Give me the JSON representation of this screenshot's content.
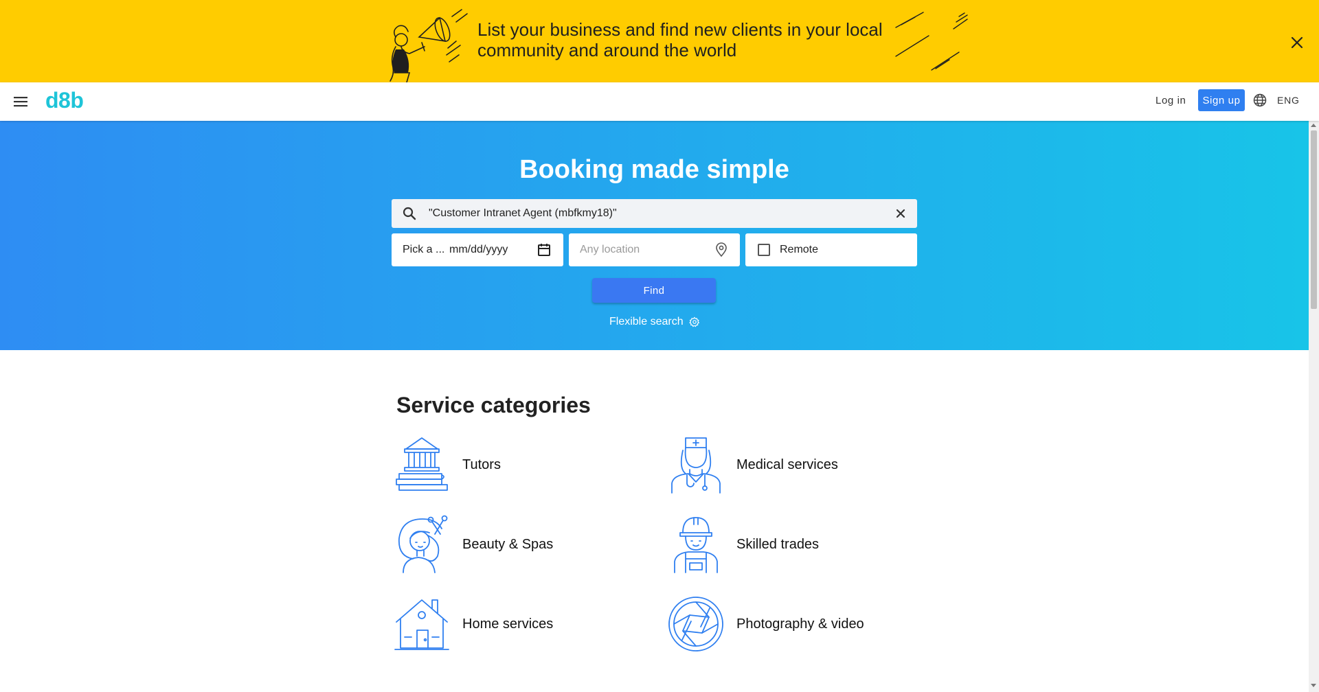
{
  "banner": {
    "text": "List your business and find new clients in your local community and around the world"
  },
  "nav": {
    "logo": "d8b",
    "login": "Log in",
    "signup": "Sign up",
    "language": "ENG"
  },
  "hero": {
    "title": "Booking made simple",
    "search_value": "\"Customer Intranet Agent (mbfkmy18)\"",
    "date_label": "Pick a ...",
    "date_placeholder": "mm/dd/yyyy",
    "location_placeholder": "Any location",
    "remote_label": "Remote",
    "remote_checked": false,
    "find_label": "Find",
    "flexible_search": "Flexible search"
  },
  "categories": {
    "title": "Service categories",
    "items": [
      {
        "label": "Tutors",
        "icon": "tutors-icon"
      },
      {
        "label": "Medical services",
        "icon": "medical-icon"
      },
      {
        "label": "Beauty & Spas",
        "icon": "beauty-icon"
      },
      {
        "label": "Skilled trades",
        "icon": "trades-icon"
      },
      {
        "label": "Home services",
        "icon": "home-icon"
      },
      {
        "label": "Photography & video",
        "icon": "camera-icon"
      }
    ]
  },
  "colors": {
    "banner": "#ffcc00",
    "brand": "#1ec4d8",
    "primary": "#2f7ff0",
    "hero_start": "#2e8df3",
    "hero_end": "#18c4e8",
    "icon_line": "#2f7ff0"
  }
}
